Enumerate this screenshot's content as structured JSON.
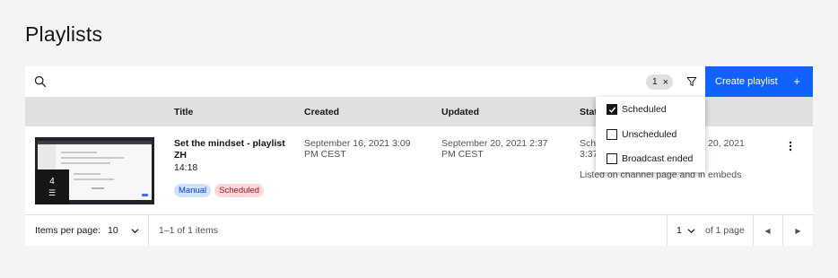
{
  "page": {
    "title": "Playlists"
  },
  "toolbar": {
    "search_placeholder": "",
    "filter_count": "1",
    "filter_clear": "×",
    "create_label": "Create playlist",
    "create_icon": "+"
  },
  "table": {
    "headers": {
      "title": "Title",
      "created": "Created",
      "updated": "Updated",
      "status": "Stat"
    },
    "rows": [
      {
        "video_count": "4",
        "title": "Set the mindset - playlist ZH",
        "duration": "14:18",
        "tags": [
          "Manual",
          "Scheduled"
        ],
        "created": "September 16, 2021 3:09 PM CEST",
        "updated": "September 20, 2021 2:37 PM CEST",
        "status_line1": "Sche",
        "status_line2": "3:37",
        "status_right": "20, 2021",
        "status_text": "Listed on channel page and in embeds"
      }
    ]
  },
  "pagination": {
    "items_per_page_label": "Items per page:",
    "items_per_page_value": "10",
    "range": "1–1 of 1 items",
    "page_value": "1",
    "of_pages": "of 1 page"
  },
  "status_filter": {
    "options": [
      {
        "label": "Scheduled",
        "checked": true
      },
      {
        "label": "Unscheduled",
        "checked": false
      },
      {
        "label": "Broadcast ended",
        "checked": false
      }
    ]
  },
  "colors": {
    "primary": "#0f62fe",
    "tag_blue_bg": "#d0e2ff",
    "tag_red_bg": "#ffd7d9"
  },
  "icons": [
    "search-icon",
    "filter-icon",
    "close-icon",
    "add-icon",
    "overflow-menu-icon",
    "chevron-down-icon",
    "caret-left-icon",
    "caret-right-icon",
    "playlist-icon",
    "checkmark-icon"
  ]
}
